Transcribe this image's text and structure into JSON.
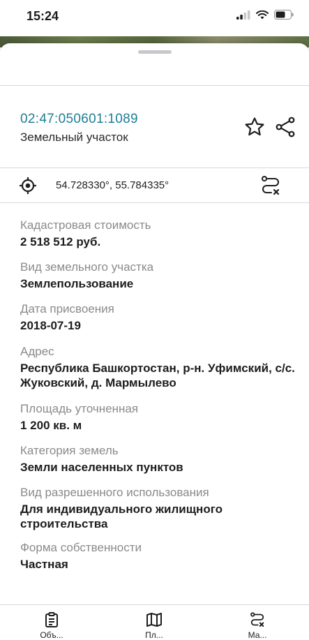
{
  "status_bar": {
    "time": "15:24"
  },
  "object": {
    "cadastral_number": "02:47:050601:1089",
    "type": "Земельный участок"
  },
  "location": {
    "coordinates": "54.728330°, 55.784335°"
  },
  "properties": [
    {
      "label": "Кадастровая стоимость",
      "value": "2 518 512 руб."
    },
    {
      "label": "Вид земельного участка",
      "value": "Землепользование"
    },
    {
      "label": "Дата присвоения",
      "value": "2018-07-19"
    },
    {
      "label": "Адрес",
      "value": "Республика Башкортостан, р-н. Уфимский, с/с. Жуковский, д. Мармылево"
    },
    {
      "label": "Площадь уточненная",
      "value": "1 200 кв. м"
    },
    {
      "label": "Категория земель",
      "value": "Земли населенных пунктов"
    },
    {
      "label": "Вид разрешенного использования",
      "value": "Для индивидуального жилищного строительства"
    },
    {
      "label": "Форма собственности",
      "value": "Частная"
    }
  ],
  "tabbar": {
    "tabs": [
      {
        "label": "Объ...",
        "icon": "clipboard-icon"
      },
      {
        "label": "Пл...",
        "icon": "map-icon"
      },
      {
        "label": "Ма...",
        "icon": "route-icon"
      }
    ]
  }
}
